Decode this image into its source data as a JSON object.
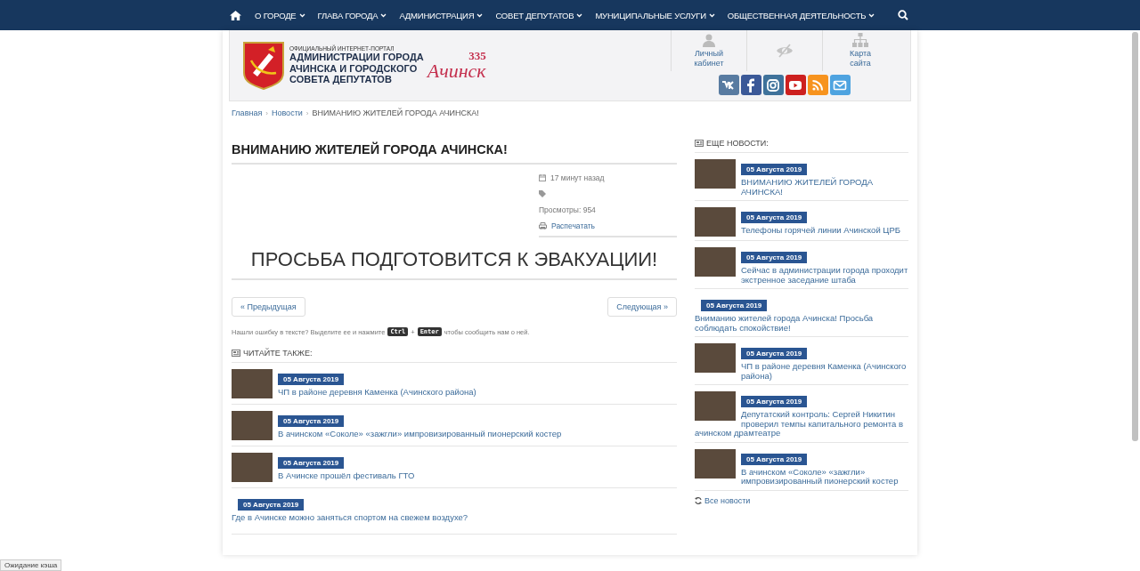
{
  "nav": {
    "items": [
      {
        "label": "О ГОРОДЕ"
      },
      {
        "label": "ГЛАВА ГОРОДА"
      },
      {
        "label": "АДМИНИСТРАЦИЯ"
      },
      {
        "label": "СОВЕТ ДЕПУТАТОВ"
      },
      {
        "label": "МУНИЦИПАЛЬНЫЕ УСЛУГИ"
      },
      {
        "label": "ОБЩЕСТВЕННАЯ ДЕЯТЕЛЬНОСТЬ"
      }
    ]
  },
  "header": {
    "portal_caption": "ОФИЦИАЛЬНЫЙ ИНТЕРНЕТ-ПОРТАЛ",
    "portal_title": [
      "АДМИНИСТРАЦИИ ГОРОДА",
      "АЧИНСКА И ГОРОДСКОГО",
      "СОВЕТА ДЕПУТАТОВ"
    ],
    "anniversary_number": "335",
    "anniversary_city": "Ачинск",
    "links": [
      {
        "kind": "user",
        "label": "Личный кабинет"
      },
      {
        "kind": "eye"
      },
      {
        "kind": "sitemap",
        "label": "Карта сайта"
      }
    ],
    "socials": [
      {
        "kind": "vk",
        "color": "#587ba1"
      },
      {
        "kind": "facebook",
        "color": "#3b5998"
      },
      {
        "kind": "instagram",
        "color": "#3f729b"
      },
      {
        "kind": "youtube",
        "color": "#cd201f"
      },
      {
        "kind": "rss",
        "color": "#f7931e"
      },
      {
        "kind": "mail",
        "color": "#4ea3e0"
      }
    ]
  },
  "breadcrumb_separator": "›",
  "breadcrumbs": [
    {
      "label": "Главная",
      "link": true
    },
    {
      "label": "Новости",
      "link": true
    },
    {
      "label": "ВНИМАНИЮ ЖИТЕЛЕЙ ГОРОДА АЧИНСКА!",
      "link": false
    }
  ],
  "article": {
    "title": "ВНИМАНИЮ ЖИТЕЛЕЙ ГОРОДА АЧИНСКА!",
    "time": "17 минут назад",
    "views": "Просмотры: 954",
    "print": "Распечатать",
    "body": "ПРОСЬБА ПОДГОТОВИТСЯ К ЭВАКУАЦИИ!",
    "prev": "« Предыдущая",
    "next": "Следующая »",
    "error_note": {
      "before": "Нашли ошибку в тексте? Выделите ее и нажмите",
      "key1": "Ctrl",
      "plus": "+",
      "key2": "Enter",
      "after": "чтобы сообщить нам о ней."
    }
  },
  "read_also": {
    "heading": "ЧИТАЙТЕ ТАКЖЕ:",
    "items": [
      {
        "kind": "photo",
        "date": "05 Августа 2019",
        "title": "ЧП в районе деревня Каменка (Ачинского района)"
      },
      {
        "kind": "photo",
        "date": "05 Августа 2019",
        "title": "В ачинском «Соколе» «зажгли» импровизированный пионерский костер"
      },
      {
        "kind": "photo",
        "date": "05 Августа 2019",
        "title": "В Ачинске прошёл фестиваль ГТО"
      },
      {
        "kind": "text",
        "date": "05 Августа 2019",
        "title": "Где в Ачинске можно заняться спортом на свежем воздухе?"
      }
    ]
  },
  "more_news": {
    "heading": "ЕЩЕ НОВОСТИ:",
    "items": [
      {
        "kind": "photo",
        "date": "05 Августа 2019",
        "title": "ВНИМАНИЮ ЖИТЕЛЕЙ ГОРОДА АЧИНСКА!"
      },
      {
        "kind": "photo",
        "date": "05 Августа 2019",
        "title": "Телефоны горячей линии Ачинской ЦРБ"
      },
      {
        "kind": "photo",
        "date": "05 Августа 2019",
        "title": "Сейчас в администрации города проходит экстренное заседание штаба"
      },
      {
        "kind": "text",
        "date": "05 Августа 2019",
        "title": "Вниманию жителей города Ачинска! Просьба соблюдать спокойствие!"
      },
      {
        "kind": "photo",
        "date": "05 Августа 2019",
        "title": "ЧП в районе деревня Каменка (Ачинского района)"
      },
      {
        "kind": "photo",
        "date": "05 Августа 2019",
        "title": "Депутатский контроль: Сергей Никитин проверил темпы капитального ремонта в ачинском драмтеатре"
      },
      {
        "kind": "photo",
        "date": "05 Августа 2019",
        "title": "В ачинском «Соколе» «зажгли» импровизированный пионерский костер"
      }
    ],
    "all_link": "Все новости"
  },
  "status_bar": "Ожидание кэша"
}
